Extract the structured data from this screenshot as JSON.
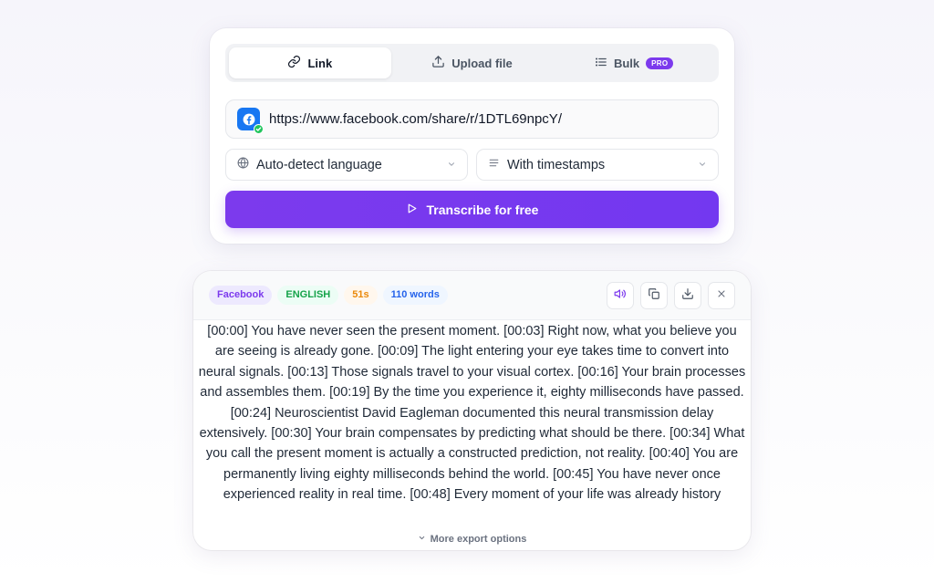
{
  "tabs": [
    {
      "label": "Link",
      "icon": "link-icon",
      "active": true
    },
    {
      "label": "Upload file",
      "icon": "upload-icon",
      "active": false
    },
    {
      "label": "Bulk",
      "icon": "list-icon",
      "active": false,
      "badge": "PRO"
    }
  ],
  "url_field": {
    "value": "https://www.facebook.com/share/r/1DTL69npcY/",
    "icon": "facebook-logo"
  },
  "language_select": {
    "value": "Auto-detect language",
    "icon": "globe-icon"
  },
  "format_select": {
    "value": "With timestamps",
    "icon": "lines-icon"
  },
  "cta": {
    "label": "Transcribe for free",
    "icon": "play-icon"
  },
  "result": {
    "badges": {
      "source": "Facebook",
      "language": "ENGLISH",
      "duration": "51s",
      "words": "110 words"
    },
    "actions": [
      "speaker-icon",
      "copy-icon",
      "download-icon",
      "close-icon"
    ],
    "transcript": "[00:00] You have never seen the present moment. [00:03] Right now, what you believe you are seeing is already gone. [00:09] The light entering your eye takes time to convert into neural signals. [00:13] Those signals travel to your visual cortex. [00:16] Your brain processes and assembles them. [00:19] By the time you experience it, eighty milliseconds have passed. [00:24] Neuroscientist David Eagleman documented this neural transmission delay extensively. [00:30] Your brain compensates by predicting what should be there. [00:34] What you call the present moment is actually a constructed prediction, not reality. [00:40] You are permanently living eighty milliseconds behind the world. [00:45] You have never once experienced reality in real time. [00:48] Every moment of your life was already history",
    "more_label": "More export options"
  },
  "colors": {
    "accent": "#7c3aed",
    "facebook": "#1877f2"
  }
}
